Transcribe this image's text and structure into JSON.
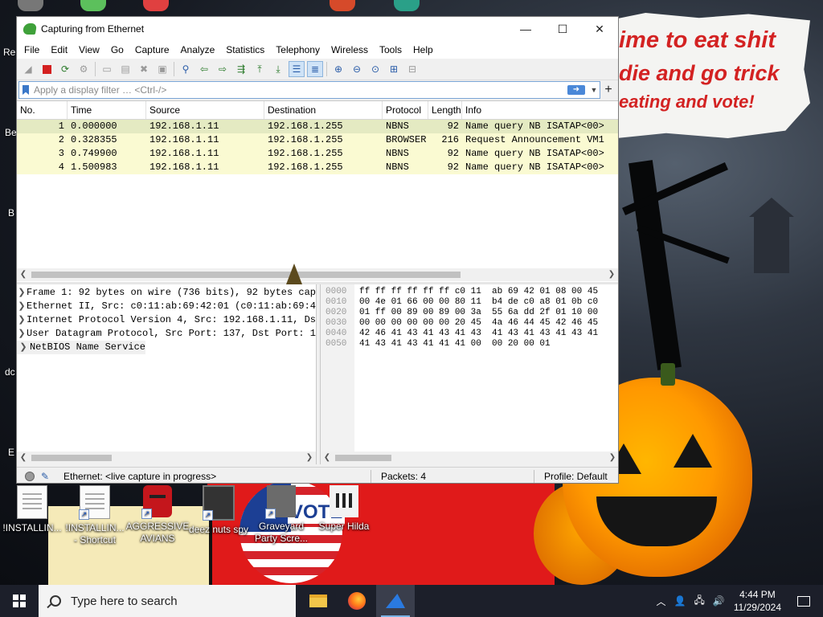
{
  "desktop": {
    "banner_lines": [
      "ime to eat shit",
      "die and go trick",
      "eating and vote!"
    ],
    "left_labels": [
      "Re",
      "Be",
      "B",
      "dc",
      "E"
    ],
    "icons": [
      {
        "label": "!INSTALLIN...",
        "kind": "doc"
      },
      {
        "label": "!INSTALLIN... - Shortcut",
        "kind": "doc"
      },
      {
        "label": "AGGRESSIVE AVIANS",
        "kind": "bird"
      },
      {
        "label": "deez nuts spy",
        "kind": "gear"
      },
      {
        "label": "Graveyard Party Scre...",
        "kind": "ghost"
      },
      {
        "label": "Super Hilda",
        "kind": "pixel"
      }
    ],
    "vote_text": "VOTE"
  },
  "window": {
    "title": "Capturing from Ethernet",
    "controls": {
      "minimize": "—",
      "maximize": "☐",
      "close": "✕"
    }
  },
  "menu": [
    "File",
    "Edit",
    "View",
    "Go",
    "Capture",
    "Analyze",
    "Statistics",
    "Telephony",
    "Wireless",
    "Tools",
    "Help"
  ],
  "filter": {
    "placeholder": "Apply a display filter … <Ctrl-/>",
    "value": "",
    "plus": "+"
  },
  "packet_list": {
    "columns": [
      "No.",
      "Time",
      "Source",
      "Destination",
      "Protocol",
      "Length",
      "Info"
    ],
    "rows": [
      {
        "no": "1",
        "time": "0.000000",
        "src": "192.168.1.11",
        "dst": "192.168.1.255",
        "proto": "NBNS",
        "len": "92",
        "info": "Name query NB ISATAP<00>"
      },
      {
        "no": "2",
        "time": "0.328355",
        "src": "192.168.1.11",
        "dst": "192.168.1.255",
        "proto": "BROWSER",
        "len": "216",
        "info": "Request Announcement VM1"
      },
      {
        "no": "3",
        "time": "0.749900",
        "src": "192.168.1.11",
        "dst": "192.168.1.255",
        "proto": "NBNS",
        "len": "92",
        "info": "Name query NB ISATAP<00>"
      },
      {
        "no": "4",
        "time": "1.500983",
        "src": "192.168.1.11",
        "dst": "192.168.1.255",
        "proto": "NBNS",
        "len": "92",
        "info": "Name query NB ISATAP<00>"
      }
    ]
  },
  "details": [
    "Frame 1: 92 bytes on wire (736 bits), 92 bytes cap",
    "Ethernet II, Src: c0:11:ab:69:42:01 (c0:11:ab:69:4",
    "Internet Protocol Version 4, Src: 192.168.1.11, Ds",
    "User Datagram Protocol, Src Port: 137, Dst Port: 1",
    "NetBIOS Name Service"
  ],
  "bytes": [
    {
      "offset": "0000",
      "hex": "ff ff ff ff ff ff c0 11  ab 69 42 01 08 00 45"
    },
    {
      "offset": "0010",
      "hex": "00 4e 01 66 00 00 80 11  b4 de c0 a8 01 0b c0"
    },
    {
      "offset": "0020",
      "hex": "01 ff 00 89 00 89 00 3a  55 6a dd 2f 01 10 00"
    },
    {
      "offset": "0030",
      "hex": "00 00 00 00 00 00 20 45  4a 46 44 45 42 46 45"
    },
    {
      "offset": "0040",
      "hex": "42 46 41 43 41 43 41 43  41 43 41 43 41 43 41"
    },
    {
      "offset": "0050",
      "hex": "41 43 41 43 41 41 41 00  00 20 00 01"
    }
  ],
  "status": {
    "interface": "Ethernet: <live capture in progress>",
    "packets": "Packets: 4",
    "profile": "Profile: Default"
  },
  "taskbar": {
    "search_placeholder": "Type here to search",
    "time": "4:44 PM",
    "date": "11/29/2024"
  }
}
